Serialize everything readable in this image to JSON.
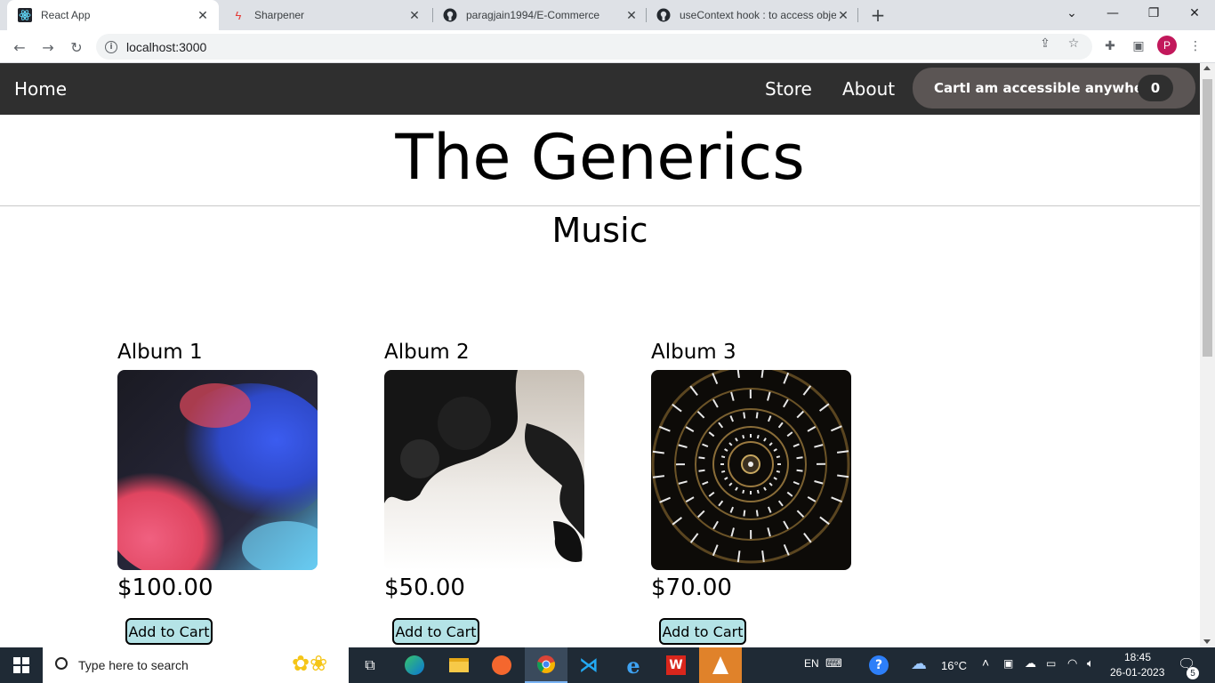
{
  "browser": {
    "tabs": [
      {
        "title": "React App",
        "active": true,
        "icon": "react-icon"
      },
      {
        "title": "Sharpener",
        "active": false,
        "icon": "sharpener-icon"
      },
      {
        "title": "paragjain1994/E-Commerce",
        "active": false,
        "icon": "github-icon"
      },
      {
        "title": "useContext hook : to access obje",
        "active": false,
        "icon": "github-icon"
      }
    ],
    "url": "localhost:3000",
    "profile_initial": "P"
  },
  "site": {
    "nav": {
      "home": "Home",
      "store": "Store",
      "about": "About",
      "cart_label": "CartI am accessible anywhere",
      "cart_count": "0"
    },
    "brand": "The Generics",
    "section_title": "Music",
    "products": [
      {
        "title": "Album 1",
        "price": "$100.00",
        "button": "Add to Cart",
        "image": "colorful-smoke"
      },
      {
        "title": "Album 2",
        "price": "$50.00",
        "button": "Add to Cart",
        "image": "black-ink"
      },
      {
        "title": "Album 3",
        "price": "$70.00",
        "button": "Add to Cart",
        "image": "light-tunnel"
      }
    ]
  },
  "taskbar": {
    "search_placeholder": "Type here to search",
    "language": "EN",
    "temperature": "16°C",
    "time": "18:45",
    "date": "26-01-2023",
    "notification_count": "5"
  },
  "colors": {
    "navbar_bg": "#2f2f2f",
    "cart_bg": "#5b5554",
    "add_button_bg": "#b4e3e6",
    "taskbar_bg": "#1f2a35"
  }
}
